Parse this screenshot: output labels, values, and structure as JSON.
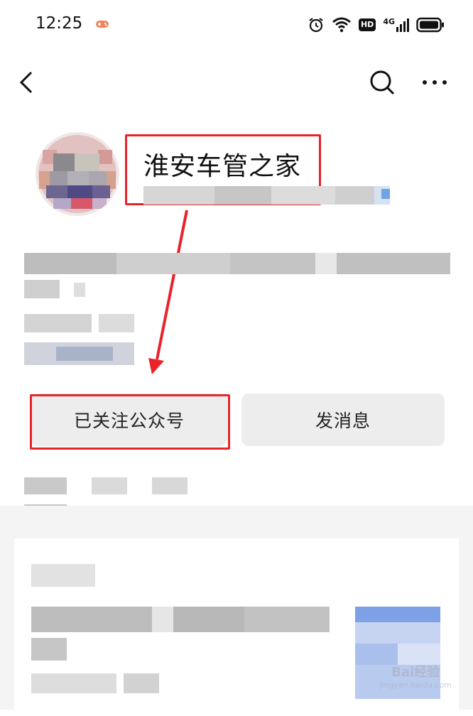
{
  "status_bar": {
    "time": "12:25",
    "hd": "HD",
    "network": "4G",
    "icons": [
      "game-icon",
      "alarm-icon",
      "wifi-icon",
      "hd-icon",
      "signal-icon",
      "battery-icon"
    ]
  },
  "nav": {
    "icons": [
      "back-icon",
      "search-icon",
      "more-icon"
    ]
  },
  "account": {
    "name": "淮安车管之家"
  },
  "buttons": {
    "followed": "已关注公众号",
    "message": "发消息"
  },
  "annotation": {
    "color": "#e8232a"
  },
  "watermark": {
    "brand": "Bai经验",
    "url": "jingyan.baidu.com"
  }
}
